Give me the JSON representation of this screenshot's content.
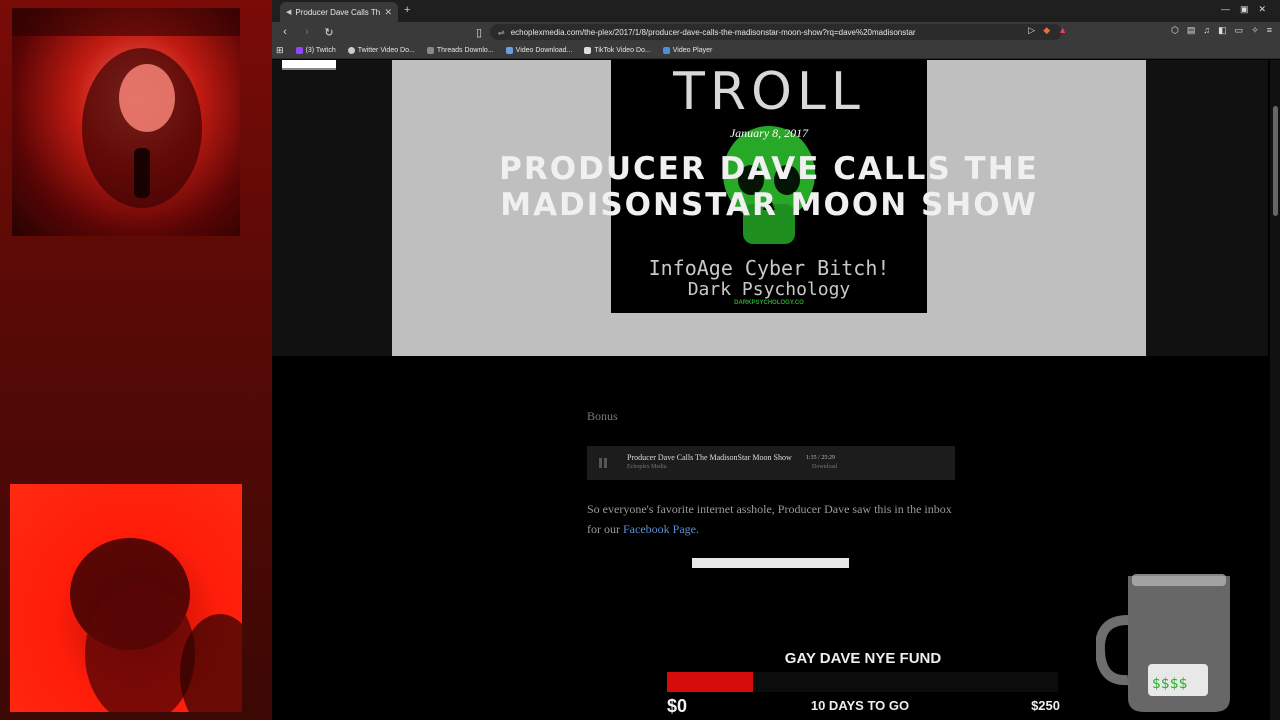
{
  "browser": {
    "tab_title": "Producer Dave Calls The M",
    "url": "echoplexmedia.com/the-plex/2017/1/8/producer-dave-calls-the-madisonstar-moon-show?rq=dave%20madisonstar",
    "bookmarks": [
      {
        "label": "(3) Twitch",
        "color": "#9146ff"
      },
      {
        "label": "Twitter Video Do...",
        "color": "#cccccc"
      },
      {
        "label": "Threads Downlo...",
        "color": "#888888"
      },
      {
        "label": "Video Download...",
        "color": "#6aa0e0"
      },
      {
        "label": "TikTok Video Do...",
        "color": "#dddddd"
      },
      {
        "label": "Video Player",
        "color": "#4a90e2"
      }
    ]
  },
  "post": {
    "date": "January 8, 2017",
    "title": "PRODUCER DAVE CALLS THE MADISONSTAR MOON SHOW",
    "image": {
      "heading": "TROLL",
      "line1": "InfoAge Cyber Bitch!",
      "line2": "Dark Psychology",
      "line3": "DARKPSYCHOLOGY.CO"
    },
    "bonus_label": "Bonus",
    "player": {
      "title": "Producer Dave Calls The MadisonStar Moon Show",
      "artist": "Echoplex Media",
      "time": "1:35 / 25:29",
      "download": "Download"
    },
    "body_text": "So everyone's favorite internet asshole, Producer Dave saw this in the inbox for our",
    "link_text": "Facebook Page",
    "link_suffix": "."
  },
  "fund": {
    "title": "GAY DAVE NYE FUND",
    "current": "$0",
    "days_left": "10 DAYS TO GO",
    "goal": "$250",
    "progress_fraction": 0.22,
    "bar_color": "#d40c0c"
  }
}
